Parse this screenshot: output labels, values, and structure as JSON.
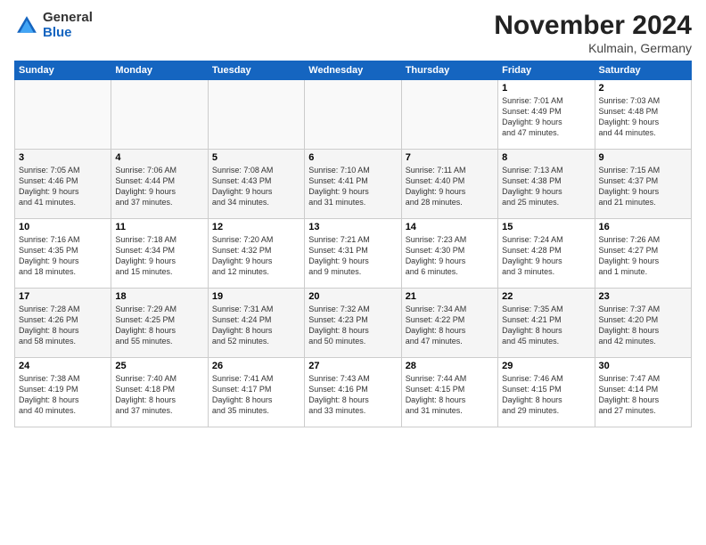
{
  "header": {
    "logo_general": "General",
    "logo_blue": "Blue",
    "month_title": "November 2024",
    "subtitle": "Kulmain, Germany"
  },
  "weekdays": [
    "Sunday",
    "Monday",
    "Tuesday",
    "Wednesday",
    "Thursday",
    "Friday",
    "Saturday"
  ],
  "weeks": [
    [
      {
        "day": "",
        "detail": ""
      },
      {
        "day": "",
        "detail": ""
      },
      {
        "day": "",
        "detail": ""
      },
      {
        "day": "",
        "detail": ""
      },
      {
        "day": "",
        "detail": ""
      },
      {
        "day": "1",
        "detail": "Sunrise: 7:01 AM\nSunset: 4:49 PM\nDaylight: 9 hours\nand 47 minutes."
      },
      {
        "day": "2",
        "detail": "Sunrise: 7:03 AM\nSunset: 4:48 PM\nDaylight: 9 hours\nand 44 minutes."
      }
    ],
    [
      {
        "day": "3",
        "detail": "Sunrise: 7:05 AM\nSunset: 4:46 PM\nDaylight: 9 hours\nand 41 minutes."
      },
      {
        "day": "4",
        "detail": "Sunrise: 7:06 AM\nSunset: 4:44 PM\nDaylight: 9 hours\nand 37 minutes."
      },
      {
        "day": "5",
        "detail": "Sunrise: 7:08 AM\nSunset: 4:43 PM\nDaylight: 9 hours\nand 34 minutes."
      },
      {
        "day": "6",
        "detail": "Sunrise: 7:10 AM\nSunset: 4:41 PM\nDaylight: 9 hours\nand 31 minutes."
      },
      {
        "day": "7",
        "detail": "Sunrise: 7:11 AM\nSunset: 4:40 PM\nDaylight: 9 hours\nand 28 minutes."
      },
      {
        "day": "8",
        "detail": "Sunrise: 7:13 AM\nSunset: 4:38 PM\nDaylight: 9 hours\nand 25 minutes."
      },
      {
        "day": "9",
        "detail": "Sunrise: 7:15 AM\nSunset: 4:37 PM\nDaylight: 9 hours\nand 21 minutes."
      }
    ],
    [
      {
        "day": "10",
        "detail": "Sunrise: 7:16 AM\nSunset: 4:35 PM\nDaylight: 9 hours\nand 18 minutes."
      },
      {
        "day": "11",
        "detail": "Sunrise: 7:18 AM\nSunset: 4:34 PM\nDaylight: 9 hours\nand 15 minutes."
      },
      {
        "day": "12",
        "detail": "Sunrise: 7:20 AM\nSunset: 4:32 PM\nDaylight: 9 hours\nand 12 minutes."
      },
      {
        "day": "13",
        "detail": "Sunrise: 7:21 AM\nSunset: 4:31 PM\nDaylight: 9 hours\nand 9 minutes."
      },
      {
        "day": "14",
        "detail": "Sunrise: 7:23 AM\nSunset: 4:30 PM\nDaylight: 9 hours\nand 6 minutes."
      },
      {
        "day": "15",
        "detail": "Sunrise: 7:24 AM\nSunset: 4:28 PM\nDaylight: 9 hours\nand 3 minutes."
      },
      {
        "day": "16",
        "detail": "Sunrise: 7:26 AM\nSunset: 4:27 PM\nDaylight: 9 hours\nand 1 minute."
      }
    ],
    [
      {
        "day": "17",
        "detail": "Sunrise: 7:28 AM\nSunset: 4:26 PM\nDaylight: 8 hours\nand 58 minutes."
      },
      {
        "day": "18",
        "detail": "Sunrise: 7:29 AM\nSunset: 4:25 PM\nDaylight: 8 hours\nand 55 minutes."
      },
      {
        "day": "19",
        "detail": "Sunrise: 7:31 AM\nSunset: 4:24 PM\nDaylight: 8 hours\nand 52 minutes."
      },
      {
        "day": "20",
        "detail": "Sunrise: 7:32 AM\nSunset: 4:23 PM\nDaylight: 8 hours\nand 50 minutes."
      },
      {
        "day": "21",
        "detail": "Sunrise: 7:34 AM\nSunset: 4:22 PM\nDaylight: 8 hours\nand 47 minutes."
      },
      {
        "day": "22",
        "detail": "Sunrise: 7:35 AM\nSunset: 4:21 PM\nDaylight: 8 hours\nand 45 minutes."
      },
      {
        "day": "23",
        "detail": "Sunrise: 7:37 AM\nSunset: 4:20 PM\nDaylight: 8 hours\nand 42 minutes."
      }
    ],
    [
      {
        "day": "24",
        "detail": "Sunrise: 7:38 AM\nSunset: 4:19 PM\nDaylight: 8 hours\nand 40 minutes."
      },
      {
        "day": "25",
        "detail": "Sunrise: 7:40 AM\nSunset: 4:18 PM\nDaylight: 8 hours\nand 37 minutes."
      },
      {
        "day": "26",
        "detail": "Sunrise: 7:41 AM\nSunset: 4:17 PM\nDaylight: 8 hours\nand 35 minutes."
      },
      {
        "day": "27",
        "detail": "Sunrise: 7:43 AM\nSunset: 4:16 PM\nDaylight: 8 hours\nand 33 minutes."
      },
      {
        "day": "28",
        "detail": "Sunrise: 7:44 AM\nSunset: 4:15 PM\nDaylight: 8 hours\nand 31 minutes."
      },
      {
        "day": "29",
        "detail": "Sunrise: 7:46 AM\nSunset: 4:15 PM\nDaylight: 8 hours\nand 29 minutes."
      },
      {
        "day": "30",
        "detail": "Sunrise: 7:47 AM\nSunset: 4:14 PM\nDaylight: 8 hours\nand 27 minutes."
      }
    ]
  ]
}
